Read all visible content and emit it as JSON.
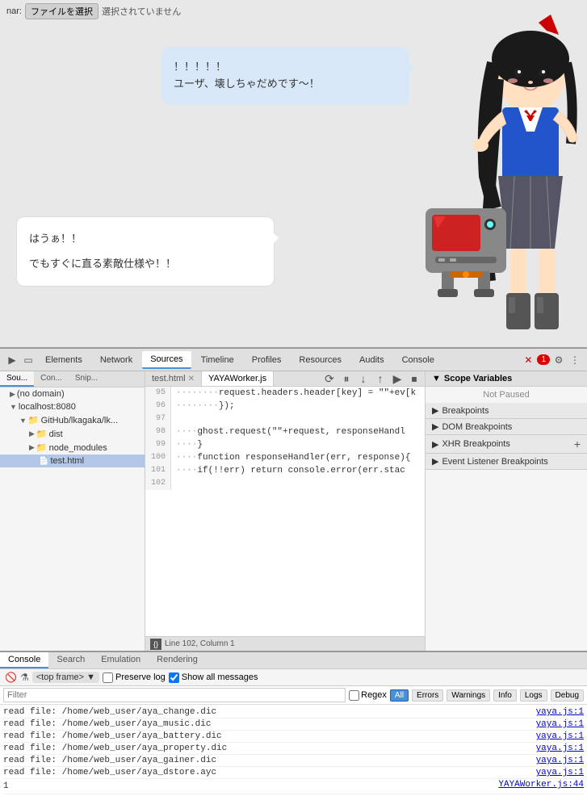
{
  "file_bar": {
    "label": "nar:",
    "button": "ファイルを選択",
    "no_file": "選択されていません"
  },
  "chat": {
    "bubble_right_text": "！！！！！\nユーザ、壊しちゃだめです～！",
    "bubble_left_line1": "はうぁ！！",
    "bubble_left_line2": "でもすぐに直る素敵仕様や！！"
  },
  "devtools": {
    "toolbar_tabs": [
      "Elements",
      "Network",
      "Sources",
      "Timeline",
      "Profiles",
      "Resources",
      "Audits",
      "Console"
    ],
    "active_tab": "Sources",
    "error_count": "1",
    "sidebar_tabs": [
      "Sou...",
      "Con...",
      "Snip..."
    ],
    "sidebar_items": [
      {
        "label": "(no domain)",
        "indent": 1,
        "type": "domain"
      },
      {
        "label": "localhost:8080",
        "indent": 1,
        "type": "domain"
      },
      {
        "label": "GitHub/lkagaka/lk...",
        "indent": 2,
        "type": "folder"
      },
      {
        "label": "dist",
        "indent": 3,
        "type": "folder"
      },
      {
        "label": "node_modules",
        "indent": 3,
        "type": "folder"
      },
      {
        "label": "test.html",
        "indent": 3,
        "type": "file",
        "selected": true
      }
    ],
    "code_tabs": [
      "test.html",
      "YAYAWorker.js"
    ],
    "active_code_tab": "YAYAWorker.js",
    "code_lines": [
      {
        "num": "95",
        "content": "········request.headers.header[key] = \"\"+ev[k"
      },
      {
        "num": "96",
        "content": "········});"
      },
      {
        "num": "97",
        "content": ""
      },
      {
        "num": "98",
        "content": "····ghost.request(\"\"+request, responseHandl"
      },
      {
        "num": "99",
        "content": "····}"
      },
      {
        "num": "100",
        "content": "····function responseHandler(err, response){"
      },
      {
        "num": "101",
        "content": "····if(!!err) return console.error(err.stac"
      },
      {
        "num": "102",
        "content": ""
      }
    ],
    "status_bar": "Line 102, Column 1",
    "scope_header": "Scope Variables",
    "not_paused": "Not Paused",
    "breakpoint_sections": [
      "Breakpoints",
      "DOM Breakpoints",
      "XHR Breakpoints",
      "Event Listener Breakpoints"
    ],
    "console_tabs": [
      "Console",
      "Search",
      "Emulation",
      "Rendering"
    ],
    "frame_label": "<top frame>",
    "preserve_log": "Preserve log",
    "show_all": "Show all messages",
    "filter_placeholder": "Filter",
    "regex_label": "Regex",
    "filter_buttons": [
      "All",
      "Errors",
      "Warnings",
      "Info",
      "Logs",
      "Debug"
    ],
    "active_filter": "All",
    "log_lines": [
      {
        "text": "read file: /home/web_user/aya_change.dic",
        "file": "yaya.js:1"
      },
      {
        "text": "read file: /home/web_user/aya_music.dic",
        "file": "yaya.js:1"
      },
      {
        "text": "read file: /home/web_user/aya_battery.dic",
        "file": "yaya.js:1"
      },
      {
        "text": "read file: /home/web_user/aya_property.dic",
        "file": "yaya.js:1"
      },
      {
        "text": "read file: /home/web_user/aya_gainer.dic",
        "file": "yaya.js:1"
      },
      {
        "text": "read file: /home/web_user/aya_dstore.ayc",
        "file": "yaya.js:1"
      }
    ],
    "bottom_number": "1",
    "bottom_file": "YAYAWorker.js:44"
  }
}
